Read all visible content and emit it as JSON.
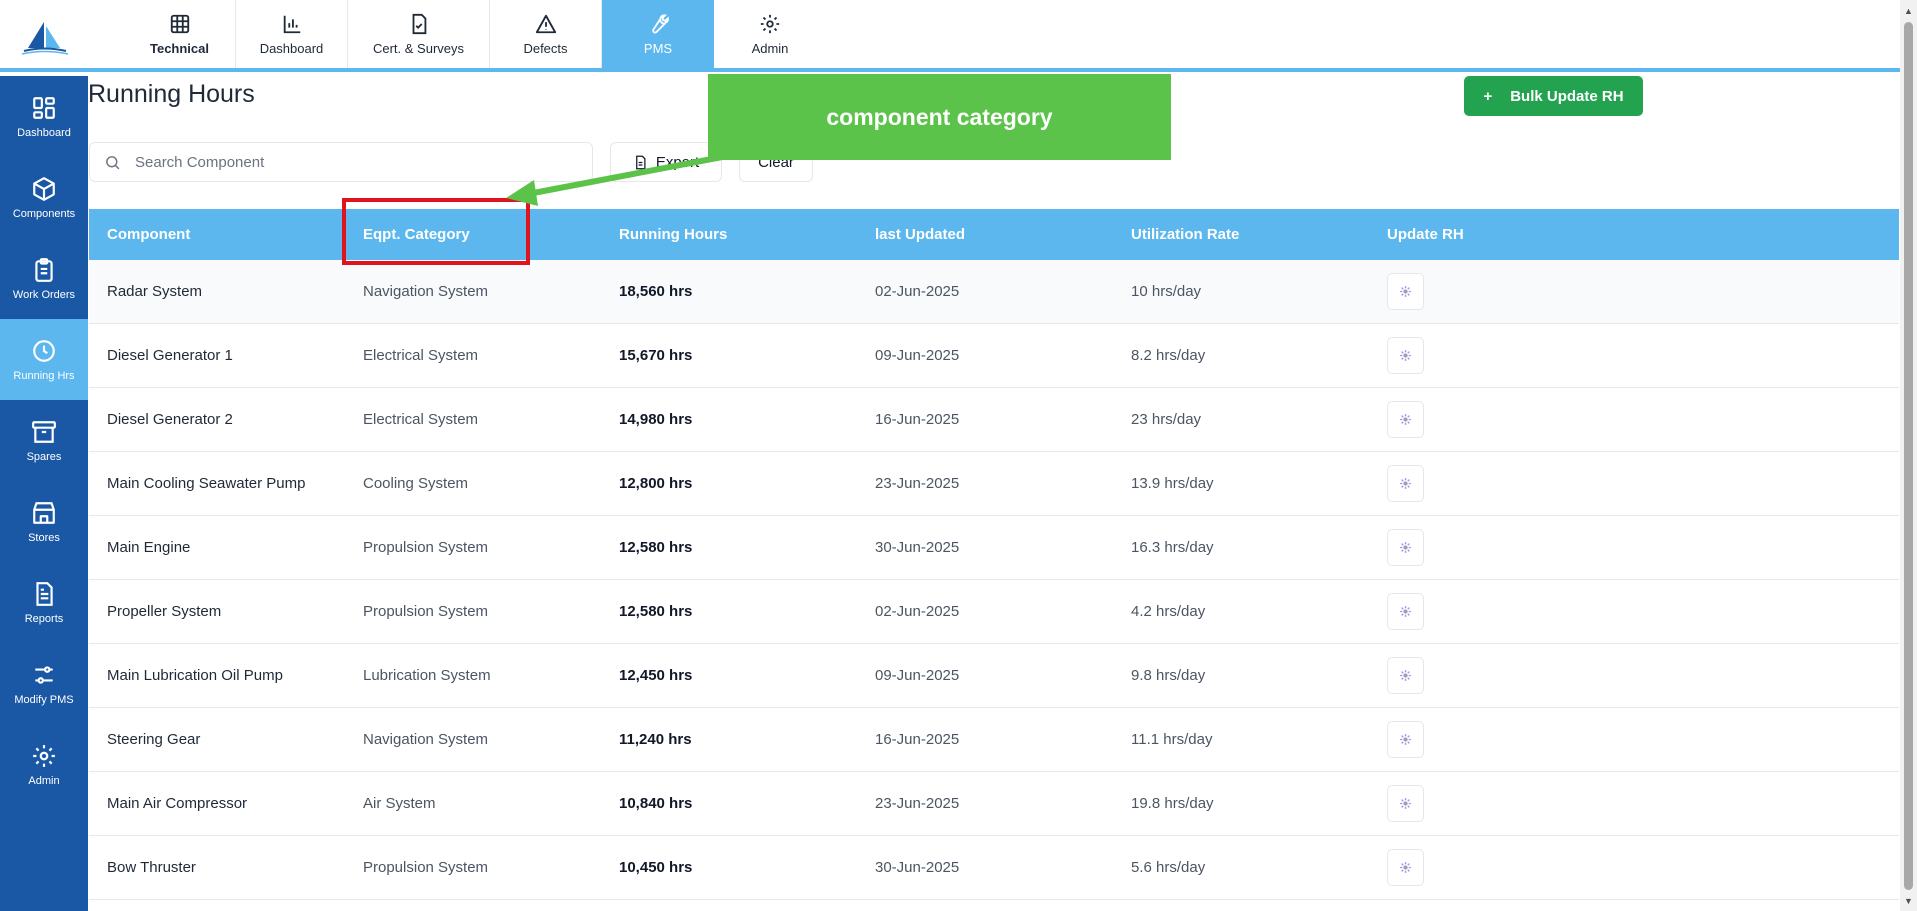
{
  "top_nav": [
    {
      "label": "Technical",
      "icon": "grid-icon"
    },
    {
      "label": "Dashboard",
      "icon": "bar-chart-icon"
    },
    {
      "label": "Cert. & Surveys",
      "icon": "certificate-icon"
    },
    {
      "label": "Defects",
      "icon": "warning-icon"
    },
    {
      "label": "PMS",
      "icon": "wrench-icon",
      "active": true
    },
    {
      "label": "Admin",
      "icon": "gear-icon"
    }
  ],
  "sidebar": [
    {
      "label": "Dashboard",
      "icon": "dashboard-icon"
    },
    {
      "label": "Components",
      "icon": "cube-icon"
    },
    {
      "label": "Work Orders",
      "icon": "clipboard-icon"
    },
    {
      "label": "Running Hrs",
      "icon": "clock-icon",
      "active": true
    },
    {
      "label": "Spares",
      "icon": "archive-box-icon"
    },
    {
      "label": "Stores",
      "icon": "store-icon"
    },
    {
      "label": "Reports",
      "icon": "document-icon"
    },
    {
      "label": "Modify PMS",
      "icon": "sliders-icon"
    },
    {
      "label": "Admin",
      "icon": "gear-icon"
    }
  ],
  "page": {
    "title": "Running Hours",
    "bulk_update_label": "Bulk Update RH",
    "bulk_update_plus": "+",
    "search_placeholder": "Search Component",
    "export_label": "Export",
    "clear_label": "Clear"
  },
  "table": {
    "headers": [
      "Component",
      "Eqpt. Category",
      "Running Hours",
      "last Updated",
      "Utilization Rate",
      "Update RH"
    ],
    "rows": [
      {
        "component": "Radar System",
        "category": "Navigation System",
        "hours": "18,560 hrs",
        "updated": "02-Jun-2025",
        "rate": "10 hrs/day"
      },
      {
        "component": "Diesel Generator 1",
        "category": "Electrical System",
        "hours": "15,670 hrs",
        "updated": "09-Jun-2025",
        "rate": "8.2 hrs/day"
      },
      {
        "component": "Diesel Generator 2",
        "category": "Electrical System",
        "hours": "14,980 hrs",
        "updated": "16-Jun-2025",
        "rate": "23 hrs/day"
      },
      {
        "component": "Main Cooling Seawater Pump",
        "category": "Cooling System",
        "hours": "12,800 hrs",
        "updated": "23-Jun-2025",
        "rate": "13.9 hrs/day"
      },
      {
        "component": "Main Engine",
        "category": "Propulsion System",
        "hours": "12,580 hrs",
        "updated": "30-Jun-2025",
        "rate": "16.3 hrs/day"
      },
      {
        "component": "Propeller System",
        "category": "Propulsion System",
        "hours": "12,580 hrs",
        "updated": "02-Jun-2025",
        "rate": "4.2 hrs/day"
      },
      {
        "component": "Main Lubrication Oil Pump",
        "category": "Lubrication System",
        "hours": "12,450 hrs",
        "updated": "09-Jun-2025",
        "rate": "9.8 hrs/day"
      },
      {
        "component": "Steering Gear",
        "category": "Navigation System",
        "hours": "11,240 hrs",
        "updated": "16-Jun-2025",
        "rate": "11.1 hrs/day"
      },
      {
        "component": "Main Air Compressor",
        "category": "Air System",
        "hours": "10,840 hrs",
        "updated": "23-Jun-2025",
        "rate": "19.8 hrs/day"
      },
      {
        "component": "Bow Thruster",
        "category": "Propulsion System",
        "hours": "10,450 hrs",
        "updated": "30-Jun-2025",
        "rate": "5.6 hrs/day"
      }
    ]
  },
  "annotation": {
    "callout_text": "component category",
    "callout_color": "#5cc34a",
    "highlight_color": "#e0141e"
  },
  "colors": {
    "accent": "#5bb7ee",
    "sidebar": "#1a58a5",
    "bulk_button": "#23a350"
  }
}
